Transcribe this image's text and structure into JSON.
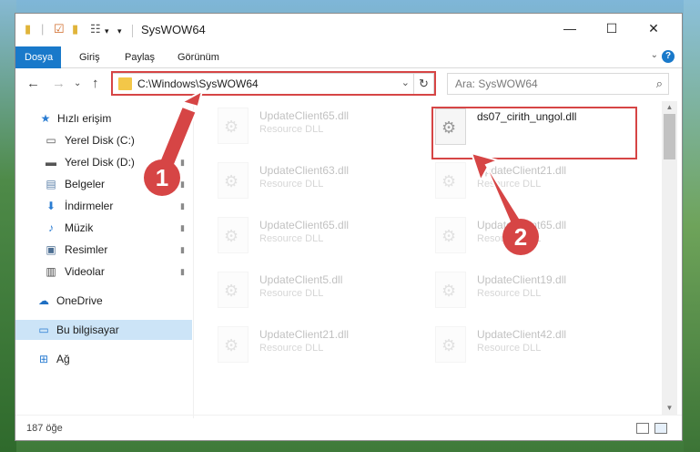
{
  "window": {
    "title": "SysWOW64",
    "qa_icons": [
      "folder-icon",
      "properties-icon",
      "new-folder-icon",
      "customize-icon"
    ],
    "controls": [
      "minimize-icon",
      "maximize-icon",
      "close-icon"
    ],
    "glyphs": {
      "minimize": "—",
      "maximize": "☐",
      "close": "✕",
      "dropdown": "▾"
    }
  },
  "ribbon": {
    "tabs": [
      "Dosya",
      "Giriş",
      "Paylaş",
      "Görünüm"
    ],
    "active_tab": "Dosya",
    "help": "?",
    "caret": "⌄"
  },
  "nav": {
    "back": "←",
    "forward": "→",
    "recent": "⌄",
    "up": "↑",
    "address": "C:\\Windows\\SysWOW64",
    "address_dropdown": "⌄",
    "refresh": "↻",
    "search_placeholder": "Ara: SysWOW64",
    "search_icon": "⌕"
  },
  "sidebar": {
    "items": [
      {
        "label": "Hızlı erişim",
        "icon": "star-icon",
        "glyph": "★",
        "color": "#2a7cd2",
        "pinned": false
      },
      {
        "label": "Yerel Disk (C:)",
        "icon": "drive-icon",
        "glyph": "▭",
        "color": "#555555",
        "pinned": true
      },
      {
        "label": "Yerel Disk (D:)",
        "icon": "drive-icon",
        "glyph": "▬",
        "color": "#555555",
        "pinned": true
      },
      {
        "label": "Belgeler",
        "icon": "documents-icon",
        "glyph": "▤",
        "color": "#5a7fa8",
        "pinned": true
      },
      {
        "label": "İndirmeler",
        "icon": "download-icon",
        "glyph": "⬇",
        "color": "#2a7cd2",
        "pinned": true
      },
      {
        "label": "Müzik",
        "icon": "music-icon",
        "glyph": "♪",
        "color": "#2a7cd2",
        "pinned": true
      },
      {
        "label": "Resimler",
        "icon": "pictures-icon",
        "glyph": "▣",
        "color": "#4d6f93",
        "pinned": true
      },
      {
        "label": "Videolar",
        "icon": "videos-icon",
        "glyph": "▥",
        "color": "#444444",
        "pinned": true
      },
      {
        "label": "OneDrive",
        "icon": "cloud-icon",
        "glyph": "☁",
        "color": "#1f6fc2",
        "pinned": false
      },
      {
        "label": "Bu bilgisayar",
        "icon": "computer-icon",
        "glyph": "▭",
        "color": "#2a7cd2",
        "pinned": false,
        "selected": true
      },
      {
        "label": "Ağ",
        "icon": "network-icon",
        "glyph": "⊞",
        "color": "#2a7cd2",
        "pinned": false
      }
    ],
    "pin_glyph": "📌"
  },
  "files": [
    {
      "name": "UpdateClient65.dll",
      "type": "Resource DLL"
    },
    {
      "name": "ds07_cirith_ungol.dll",
      "type": ""
    },
    {
      "name": "UpdateClient63.dll",
      "type": "Resource DLL"
    },
    {
      "name": "UpdateClient21.dll",
      "type": "Resource DLL"
    },
    {
      "name": "UpdateClient65.dll",
      "type": "Resource DLL"
    },
    {
      "name": "UpdateClient65.dll",
      "type": "Resource DLL"
    },
    {
      "name": "UpdateClient5.dll",
      "type": "Resource DLL"
    },
    {
      "name": "UpdateClient19.dll",
      "type": "Resource DLL"
    },
    {
      "name": "UpdateClient21.dll",
      "type": "Resource DLL"
    },
    {
      "name": "UpdateClient42.dll",
      "type": "Resource DLL"
    }
  ],
  "status": {
    "count": "187 öğe"
  },
  "callouts": {
    "one": "1",
    "two": "2"
  },
  "colors": {
    "accent": "#1979ca",
    "highlight": "#d64545",
    "selected": "#cce4f7"
  }
}
